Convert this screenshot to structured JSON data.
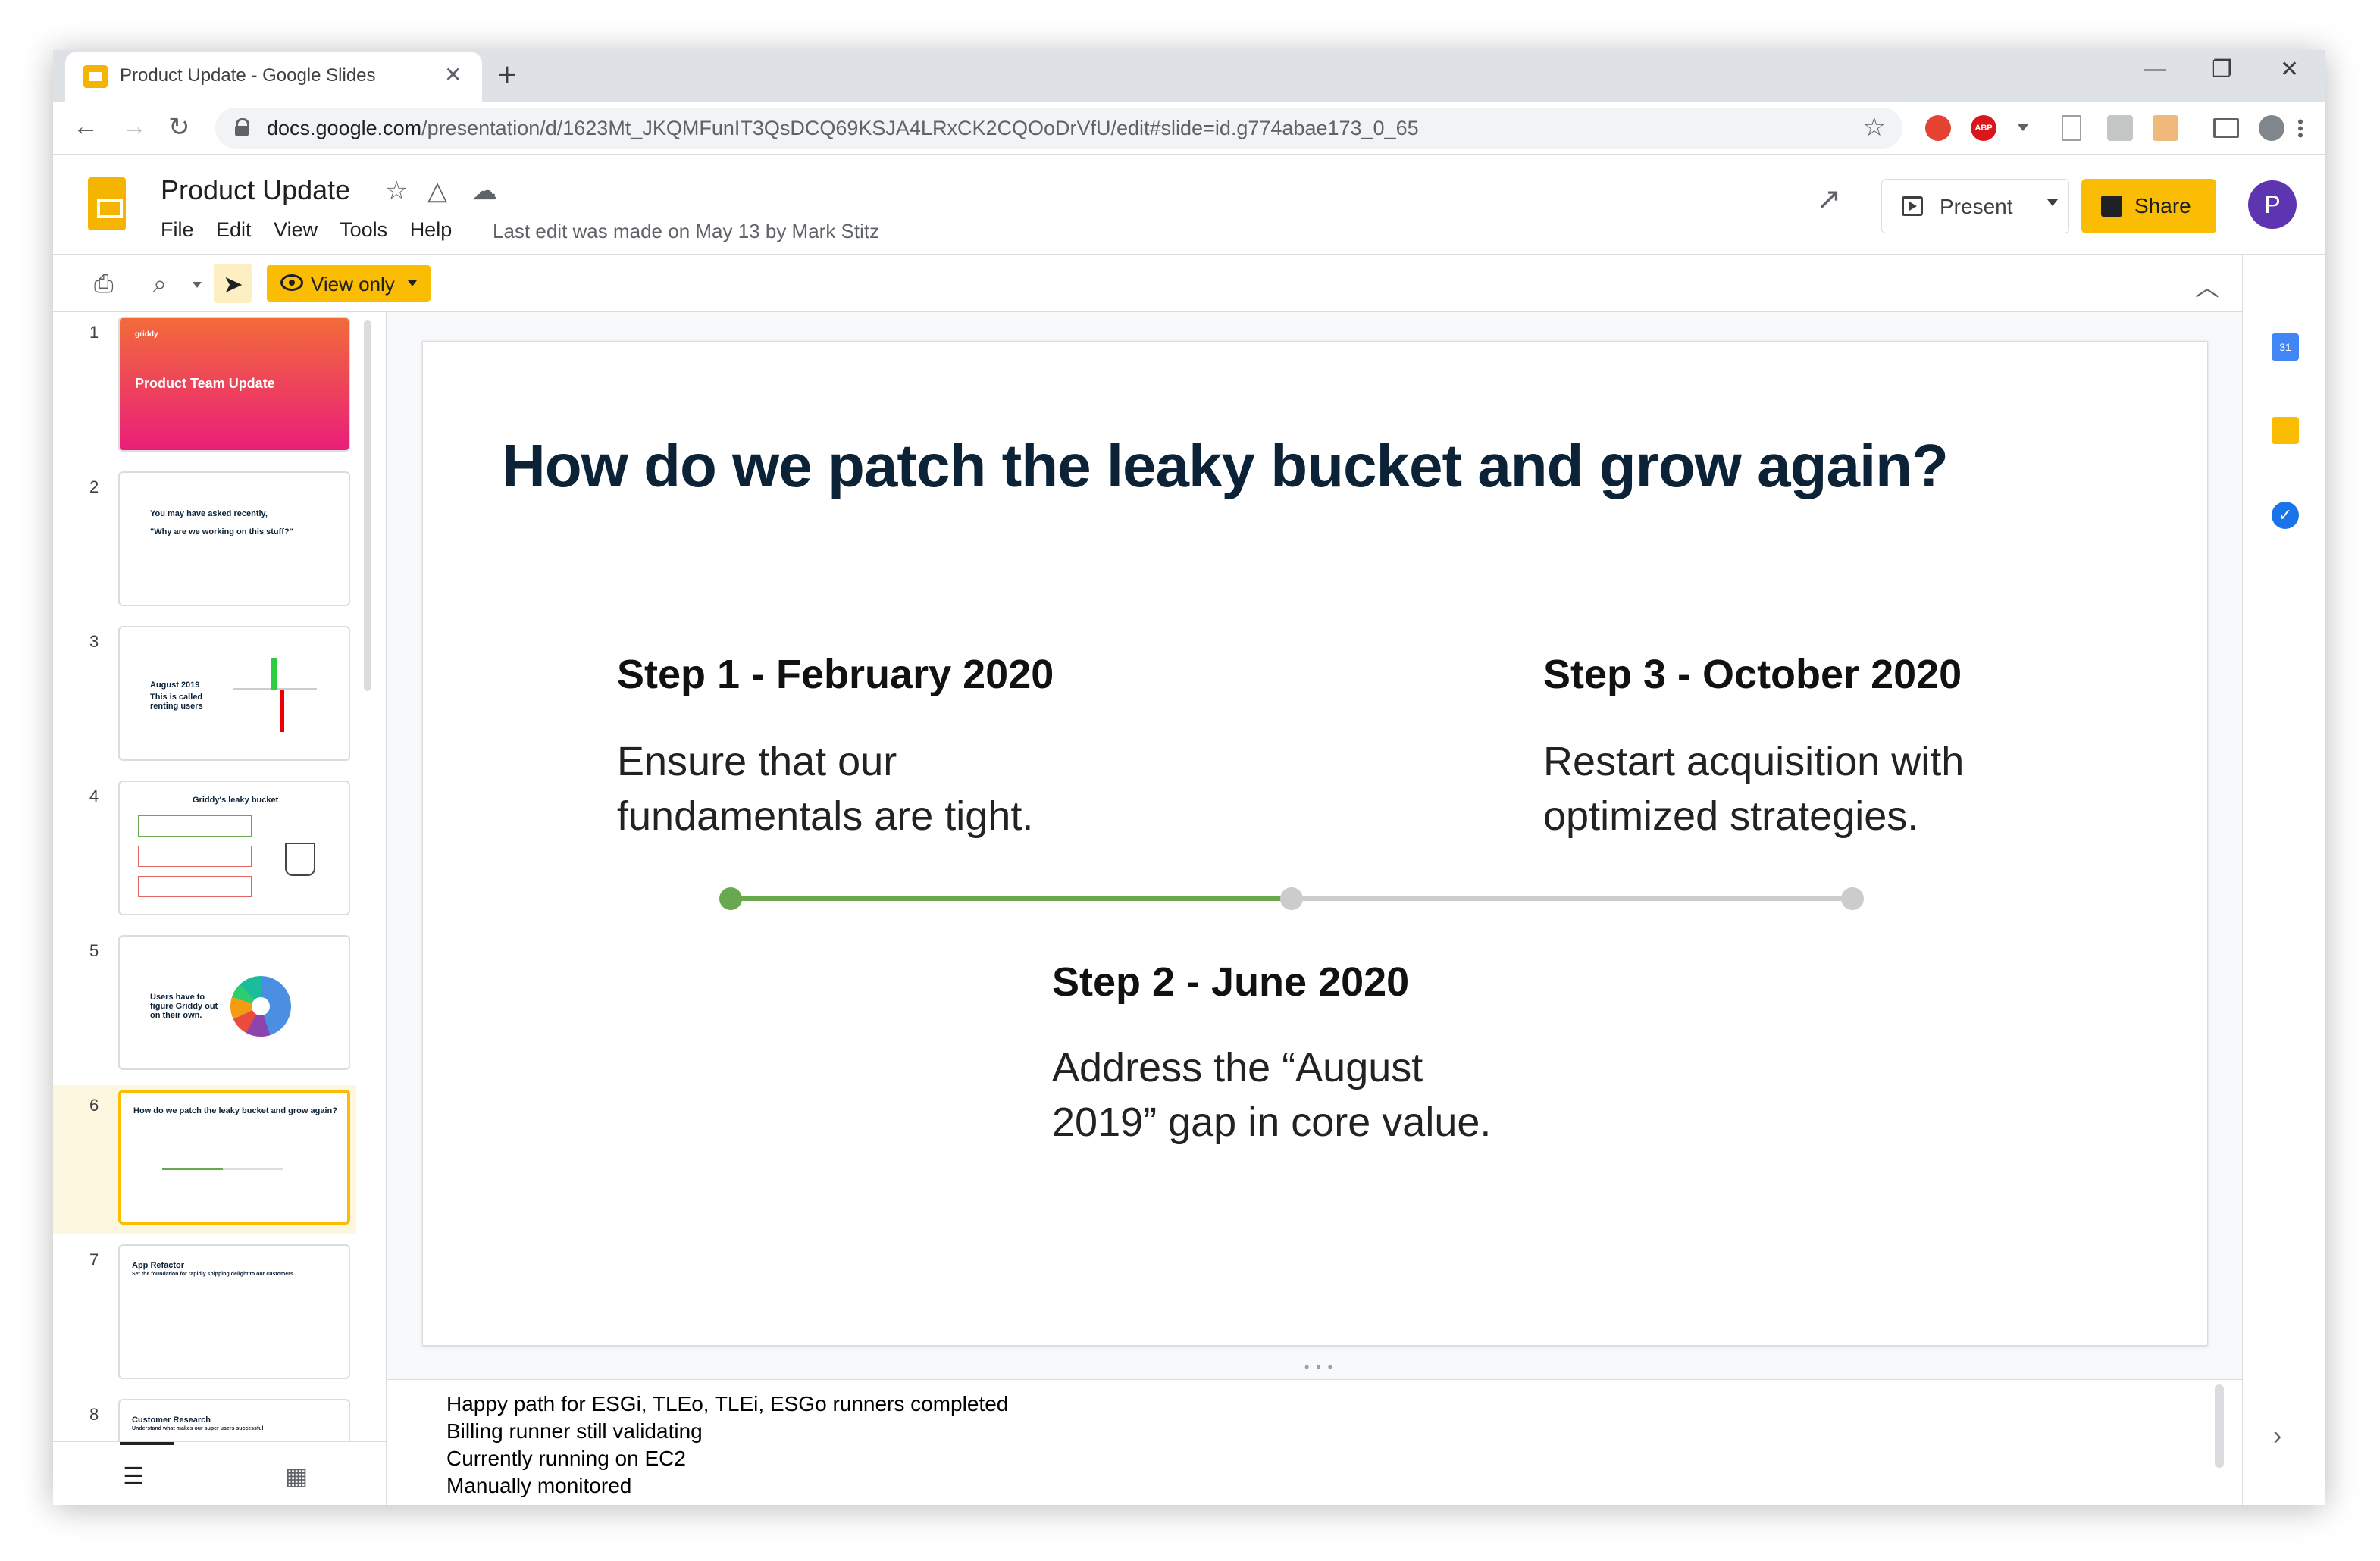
{
  "browser": {
    "tab_title": "Product Update - Google Slides",
    "tab_close": "✕",
    "new_tab": "+",
    "window_controls": [
      "—",
      "❐",
      "✕"
    ],
    "url_host": "docs.google.com",
    "url_path": "/presentation/d/1623Mt_JKQMFunIT3QsDCQ69KSJA4LRxCK2CQOoDrVfU/edit#slide=id.g774abae173_0_65",
    "back": "←",
    "forward": "→",
    "reload": "↻",
    "star": "☆",
    "extensions": [
      {
        "name": "todoist-extension-icon",
        "color": "#e44332",
        "label": "T"
      },
      {
        "name": "adblock-extension-icon",
        "color": "#d9161b",
        "label": "ABP"
      }
    ]
  },
  "app": {
    "title": "Product Update",
    "menus": [
      "File",
      "Edit",
      "View",
      "Tools",
      "Help"
    ],
    "last_edit": "Last edit was made on May 13 by Mark Stitz",
    "present_label": "Present",
    "share_label": "Share",
    "avatar_letter": "P",
    "view_only_label": "View only",
    "accent_color": "#fbbc04"
  },
  "filmstrip": {
    "slides": [
      {
        "num": "1",
        "text": "griddy",
        "title": "Product Team Update"
      },
      {
        "num": "2",
        "text": "You may have asked recently,",
        "title": "\"Why are we working on this stuff?\""
      },
      {
        "num": "3",
        "text": "August 2019",
        "title": "This is called renting users"
      },
      {
        "num": "4",
        "text": "Griddy's leaky bucket",
        "title": ""
      },
      {
        "num": "5",
        "text": "Users have to figure Griddy out on their own.",
        "title": ""
      },
      {
        "num": "6",
        "text": "How do we patch the leaky bucket and grow again?",
        "title": ""
      },
      {
        "num": "7",
        "text": "App Refactor",
        "title": "Set the foundation for rapidly shipping delight to our customers"
      },
      {
        "num": "8",
        "text": "Customer Research",
        "title": "Understand what makes our super users successful"
      }
    ],
    "selected": 6
  },
  "slide": {
    "heading": "How do we patch the leaky bucket and grow again?",
    "steps": [
      {
        "title": "Step 1 - February 2020",
        "body": "Ensure that our fundamentals are tight."
      },
      {
        "title": "Step 2 - June 2020",
        "body": "Address the “August 2019” gap in core value."
      },
      {
        "title": "Step 3 - October 2020",
        "body": "Restart acquisition with optimized strategies."
      }
    ],
    "progress_fraction": 0.5,
    "progress_color": "#6aa84f",
    "track_color": "#cccccc"
  },
  "notes": [
    "Happy path for ESGi, TLEo, TLEi, ESGo runners completed",
    "Billing runner still validating",
    "Currently running on EC2",
    "Manually monitored"
  ]
}
